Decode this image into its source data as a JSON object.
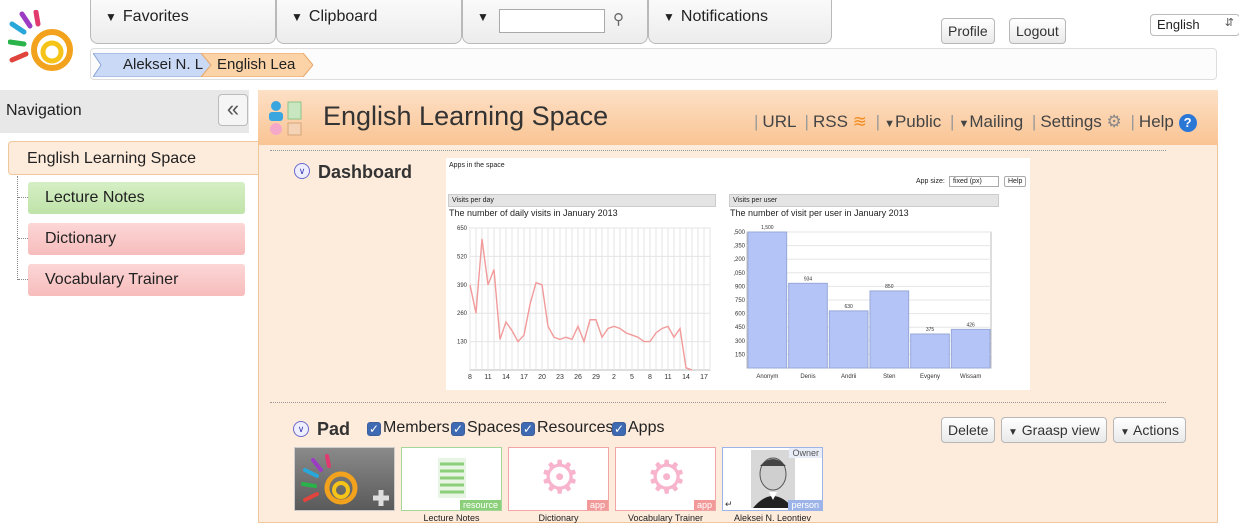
{
  "top": {
    "favorites": "Favorites",
    "clipboard": "Clipboard",
    "notifications": "Notifications",
    "search_value": "",
    "profile": "Profile",
    "logout": "Logout",
    "language": "English"
  },
  "breadcrumb": [
    "Aleksei N. L",
    "English Lea"
  ],
  "nav": {
    "title": "Navigation",
    "collapse": "«",
    "active": "English Learning Space",
    "items": [
      "Lecture Notes",
      "Dictionary",
      "Vocabulary Trainer"
    ]
  },
  "space": {
    "title": "English Learning Space",
    "links": [
      "URL",
      "RSS",
      "Public",
      "Mailing",
      "Settings",
      "Help"
    ]
  },
  "dashboard": {
    "title": "Dashboard",
    "header": "Apps in the space",
    "app_size_label": "App size:",
    "app_size_value": "fixed (px)",
    "help": "Help"
  },
  "chart_data": [
    {
      "type": "line",
      "panel_title": "Visits per day",
      "title": "The number of daily visits in January 2013",
      "x": [
        8,
        9,
        10,
        11,
        12,
        13,
        14,
        15,
        16,
        17,
        18,
        19,
        20,
        21,
        22,
        23,
        24,
        25,
        26,
        27,
        28,
        29,
        30,
        31,
        1,
        2,
        3,
        4,
        5,
        6,
        7,
        8,
        9,
        10,
        11,
        12,
        13,
        14,
        15,
        16,
        17
      ],
      "x_ticks": [
        "8",
        "11",
        "14",
        "17",
        "20",
        "23",
        "26",
        "29",
        "2",
        "5",
        "8",
        "11",
        "14",
        "17"
      ],
      "values": [
        390,
        260,
        600,
        390,
        460,
        140,
        220,
        180,
        130,
        160,
        300,
        400,
        390,
        200,
        150,
        140,
        150,
        140,
        200,
        130,
        230,
        230,
        150,
        190,
        200,
        190,
        170,
        160,
        150,
        130,
        130,
        170,
        190,
        200,
        150,
        190,
        10,
        0,
        0,
        0,
        0
      ],
      "yticks": [
        130,
        260,
        390,
        520,
        650
      ],
      "ylim": [
        0,
        650
      ]
    },
    {
      "type": "bar",
      "panel_title": "Visits per user",
      "title": "The number of visit per user in January 2013",
      "categories": [
        "Anonym",
        "Denis",
        "Andrii",
        "Sten",
        "Evgeny",
        "Wissam"
      ],
      "values": [
        1500,
        934,
        630,
        850,
        375,
        426
      ],
      "value_labels": [
        "1,500",
        "934",
        "630",
        "850",
        "375",
        "426"
      ],
      "yticks": [
        ",500",
        ",350",
        ",200",
        ",050",
        "900",
        "750",
        "600",
        "450",
        "300",
        "150"
      ],
      "ylim": [
        0,
        1500
      ],
      "color": "#b4c4f6"
    }
  ],
  "pad": {
    "title": "Pad",
    "filters": [
      "Members",
      "Spaces",
      "Resources",
      "Apps"
    ],
    "delete": "Delete",
    "view": "Graasp view",
    "actions": "Actions",
    "tiles": [
      {
        "label": "",
        "badge": ""
      },
      {
        "label": "Lecture Notes",
        "badge": "resource"
      },
      {
        "label": "Dictionary",
        "badge": "app"
      },
      {
        "label": "Vocabulary Trainer",
        "badge": "app"
      },
      {
        "label": "Aleksei N. Leontiev",
        "badge": "person",
        "tag": "Owner"
      }
    ]
  },
  "colors": {
    "accent": "#f9c493",
    "nav_green": "#bfe3a8",
    "nav_red": "#f7bcbc",
    "line": "#f29a9a",
    "bar": "#b4c4f6"
  }
}
